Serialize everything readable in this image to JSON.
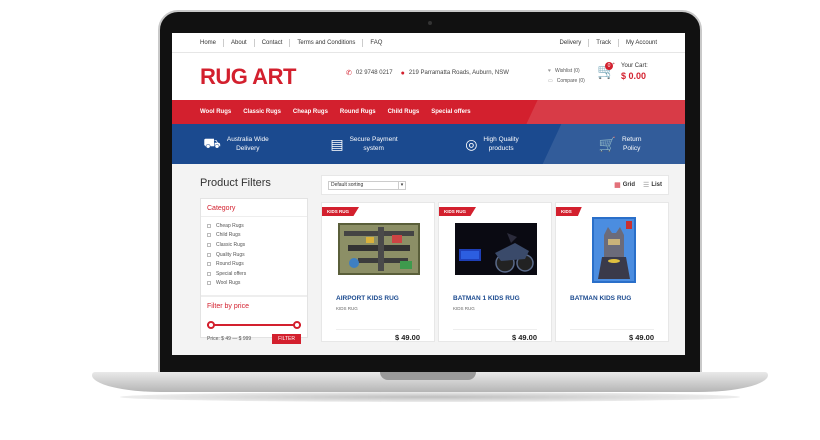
{
  "topbar": {
    "left": [
      "Home",
      "About",
      "Contact",
      "Terms and Conditions",
      "FAQ"
    ],
    "right": [
      "Delivery",
      "Track",
      "My Account"
    ]
  },
  "header": {
    "logo": "RUG ART",
    "phone": "02 9748 0217",
    "address": "219 Parramatta Roads, Auburn, NSW",
    "wishlist": "Wishlist (0)",
    "compare": "Compare (0)",
    "cart_label": "Your Cart:",
    "cart_total": "$ 0.00",
    "cart_count": "0"
  },
  "nav": [
    "Wool Rugs",
    "Classic Rugs",
    "Cheap Rugs",
    "Round Rugs",
    "Child Rugs",
    "Special offers"
  ],
  "features": [
    {
      "line1": "Australia Wide",
      "line2": "Delivery",
      "icon": "truck-icon"
    },
    {
      "line1": "Secure Payment",
      "line2": "system",
      "icon": "card-icon"
    },
    {
      "line1": "High Quality",
      "line2": "products",
      "icon": "quality-icon"
    },
    {
      "line1": "Return",
      "line2": "Policy",
      "icon": "cart-return-icon"
    }
  ],
  "filters": {
    "title": "Product Filters",
    "category_heading": "Category",
    "categories": [
      "Cheap Rugs",
      "Child Rugs",
      "Classic Rugs",
      "Quality Rugs",
      "Round Rugs",
      "Special offers",
      "Wool Rugs"
    ],
    "price_heading": "Filter by price",
    "price_text": "Price: $ 49 — $ 999",
    "filter_button": "FILTER"
  },
  "sortbar": {
    "sort_value": "Default sorting",
    "grid_label": "Grid",
    "list_label": "List"
  },
  "products": [
    {
      "badge": "KIDS RUG",
      "name": "AIRPORT KIDS RUG",
      "tag": "KIDS RUG",
      "price": "$ 49.00"
    },
    {
      "badge": "KIDS RUG",
      "name": "BATMAN 1 KIDS RUG",
      "tag": "KIDS RUG",
      "price": "$ 49.00"
    },
    {
      "badge": "KIDS",
      "name": "BATMAN KIDS RUG",
      "tag": "",
      "price": "$ 49.00"
    }
  ],
  "colors": {
    "brand_red": "#d3202e",
    "brand_blue": "#1b4a8f"
  }
}
